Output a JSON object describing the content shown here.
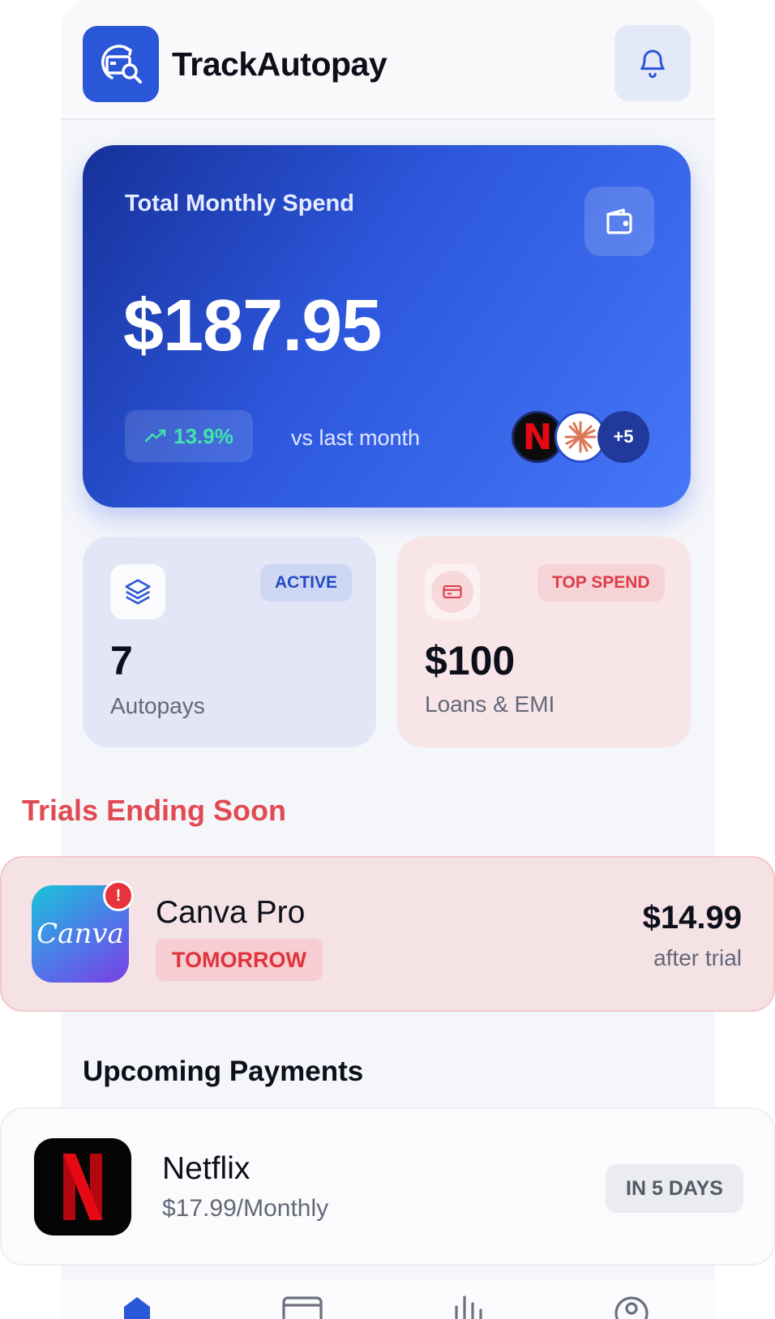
{
  "header": {
    "app_title": "TrackAutopay",
    "logo_icon": "card-search-icon",
    "bell_icon": "bell-icon"
  },
  "summary": {
    "label": "Total Monthly Spend",
    "amount": "$187.95",
    "trend_value": "13.9%",
    "trend_icon": "trending-up-icon",
    "trend_caption": "vs last month",
    "wallet_icon": "wallet-icon",
    "avatar_more": "+5",
    "colors": {
      "gradient_start": "#17319a",
      "gradient_end": "#4677f7",
      "trend_green": "#3ee6a8"
    }
  },
  "stats": {
    "active": {
      "tag": "ACTIVE",
      "value": "7",
      "label": "Autopays",
      "icon": "layers-icon"
    },
    "top_spend": {
      "tag": "TOP SPEND",
      "value": "$100",
      "label": "Loans & EMI",
      "icon": "credit-card-icon"
    }
  },
  "trials": {
    "section_title": "Trials Ending Soon",
    "items": [
      {
        "name": "Canva Pro",
        "logo_text": "Canva",
        "badge": "TOMORROW",
        "price": "$14.99",
        "price_caption": "after trial",
        "alert": "!"
      }
    ]
  },
  "upcoming": {
    "section_title": "Upcoming Payments",
    "items": [
      {
        "name": "Netflix",
        "logo_text": "N",
        "detail": "$17.99/Monthly",
        "badge": "IN 5 DAYS"
      }
    ]
  },
  "nav": {
    "items": [
      "home-icon",
      "card-icon",
      "chart-icon",
      "profile-icon"
    ],
    "accent": "#2a56d8"
  }
}
